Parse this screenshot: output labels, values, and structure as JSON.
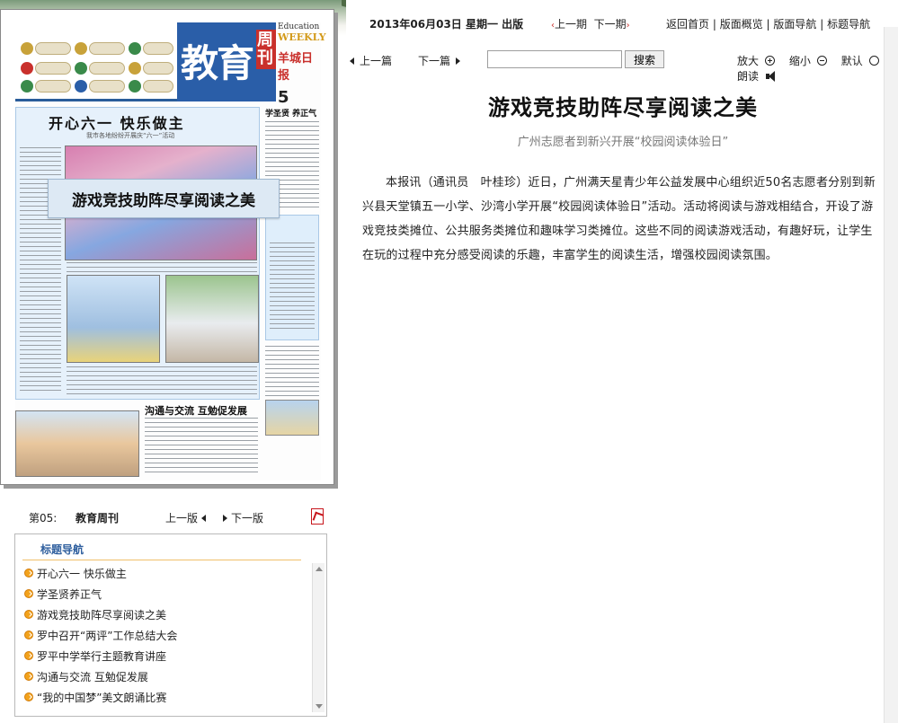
{
  "header": {
    "date": "2013年06月03日 星期一 出版",
    "issue_prev": "上一期",
    "issue_next": "下一期",
    "links": [
      "返回首页",
      "版面概览",
      "版面导航",
      "标题导航"
    ]
  },
  "toolbar": {
    "prev_article": "上一篇",
    "next_article": "下一篇",
    "search_value": "",
    "search_button": "搜索",
    "zoom_in": "放大",
    "zoom_out": "缩小",
    "default": "默认",
    "read_aloud": "朗读"
  },
  "newspaper": {
    "title_big": "教育",
    "title_side": "周刊",
    "edu_label": "Education",
    "weekly_label": "WEEKLY",
    "paper_name": "羊城日报",
    "page_num": "5",
    "lead_title": "开心六一  快乐做主",
    "lead_sub": "我市各地纷纷开展庆“六一”活动",
    "right_head": "学圣贤 养正气",
    "bottom_title": "沟通与交流  互勉促发展",
    "hover_title": "游戏竞技助阵尽享阅读之美"
  },
  "page_nav": {
    "page_label": "第05:",
    "page_name": "教育周刊",
    "prev_page": "上一版",
    "next_page": "下一版"
  },
  "toc": {
    "heading": "标题导航",
    "items": [
      "开心六一 快乐做主",
      "学圣贤养正气",
      "游戏竞技助阵尽享阅读之美",
      "罗中召开“两评”工作总结大会",
      "罗平中学举行主题教育讲座",
      "沟通与交流  互勉促发展",
      "“我的中国梦”美文朗诵比赛"
    ]
  },
  "article": {
    "title": "游戏竞技助阵尽享阅读之美",
    "subtitle": "广州志愿者到新兴开展“校园阅读体验日”",
    "body": "本报讯（通讯员　叶桂珍）近日，广州满天星青少年公益发展中心组织近50名志愿者分别到新兴县天堂镇五一小学、沙湾小学开展“校园阅读体验日”活动。活动将阅读与游戏相结合，开设了游戏竞技类摊位、公共服务类摊位和趣味学习类摊位。这些不同的阅读游戏活动，有趣好玩，让学生在玩的过程中充分感受阅读的乐趣，丰富学生的阅读生活，增强校园阅读氛围。"
  },
  "colors": {
    "accent_blue": "#2a5ea8",
    "toc_heading": "#2f5f9e",
    "bullet_orange": "#f3a21b",
    "red": "#c9302c"
  },
  "icons": [
    "zoom-in-icon",
    "zoom-out-icon",
    "default-zoom-icon",
    "speaker-icon",
    "pdf-icon",
    "scroll-up-icon",
    "scroll-down-icon"
  ]
}
